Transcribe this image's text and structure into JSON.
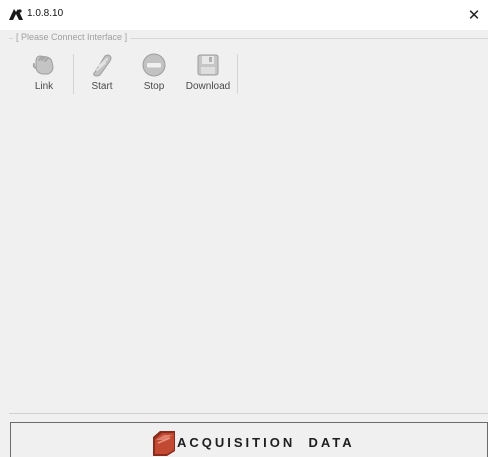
{
  "window": {
    "title": "1.0.8.10",
    "close_glyph": "✕",
    "icon": "app-logo-icon"
  },
  "interface": {
    "status_label": "[ Please Connect Interface ]"
  },
  "toolbar": {
    "buttons": [
      {
        "label": "Link",
        "icon": "link-hand-icon",
        "enabled": false
      },
      {
        "label": "Start",
        "icon": "start-icon",
        "enabled": false
      },
      {
        "label": "Stop",
        "icon": "stop-icon",
        "enabled": false
      },
      {
        "label": "Download",
        "icon": "download-floppy-icon",
        "enabled": false
      }
    ]
  },
  "footer": {
    "title": "ACQUISITION  DATA",
    "icon": "folder-icon"
  },
  "colors": {
    "background": "#f0f0f0",
    "titlebar": "#ffffff",
    "disabled_icon": "#b8b8b8",
    "folder_accent": "#a23a28"
  }
}
